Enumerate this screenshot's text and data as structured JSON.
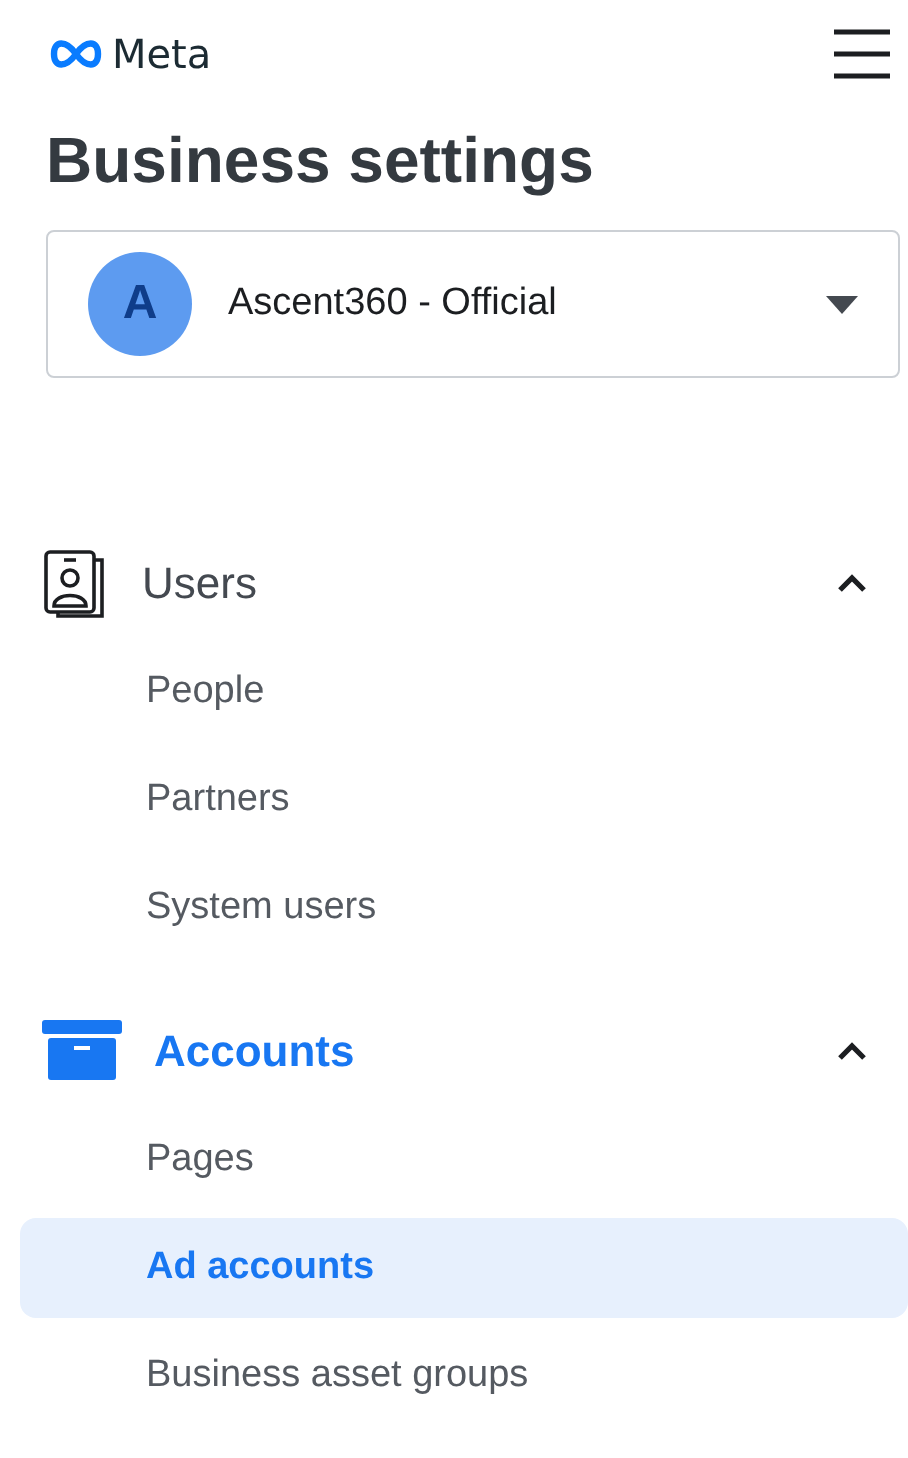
{
  "brand": {
    "name": "Meta"
  },
  "title": "Business settings",
  "account": {
    "initial": "A",
    "name": "Ascent360 - Official"
  },
  "sections": [
    {
      "label": "Users",
      "kind": "users",
      "selected": false,
      "expanded": true,
      "items": [
        {
          "label": "People",
          "selected": false
        },
        {
          "label": "Partners",
          "selected": false
        },
        {
          "label": "System users",
          "selected": false
        }
      ]
    },
    {
      "label": "Accounts",
      "kind": "accounts",
      "selected": true,
      "expanded": true,
      "items": [
        {
          "label": "Pages",
          "selected": false
        },
        {
          "label": "Ad accounts",
          "selected": true
        },
        {
          "label": "Business asset groups",
          "selected": false
        }
      ]
    }
  ]
}
